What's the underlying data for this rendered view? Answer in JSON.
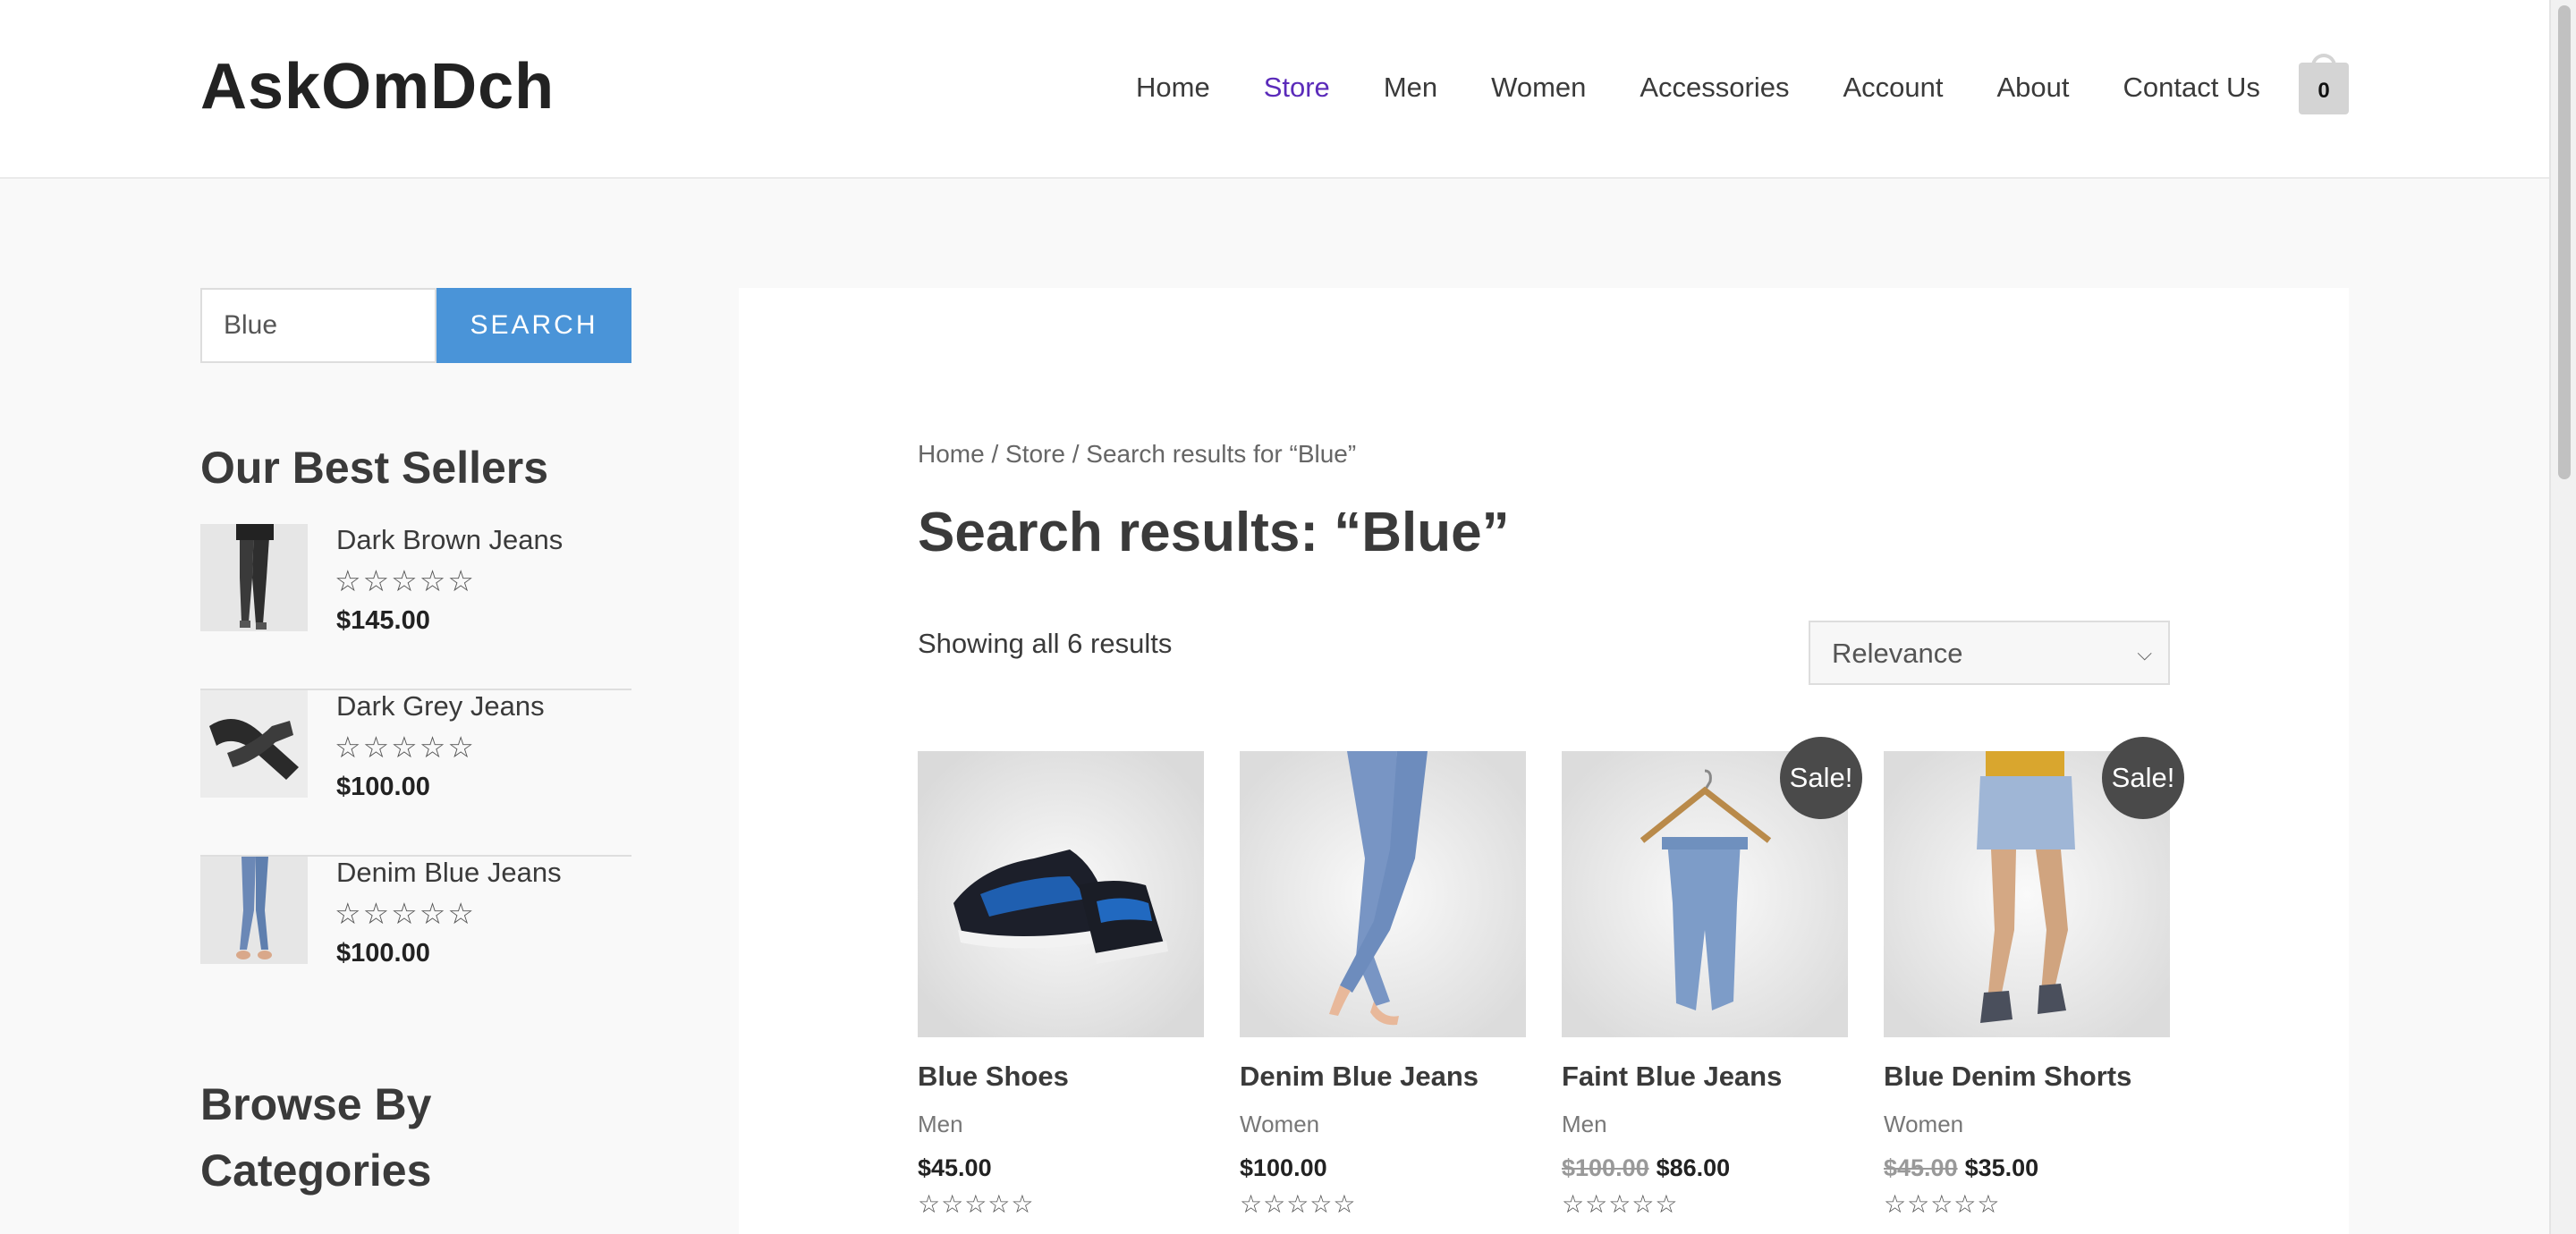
{
  "site": {
    "logo": "AskOmDch",
    "cart_count": "0"
  },
  "nav": [
    "Home",
    "Store",
    "Men",
    "Women",
    "Accessories",
    "Account",
    "About",
    "Contact Us"
  ],
  "nav_active": "Store",
  "sidebar": {
    "search_value": "Blue",
    "search_button": "SEARCH",
    "best_sellers_title": "Our Best Sellers",
    "best_sellers": [
      {
        "name": "Dark Brown Jeans",
        "price": "$145.00",
        "stars": "☆☆☆☆☆",
        "rating": 0
      },
      {
        "name": "Dark Grey Jeans",
        "price": "$100.00",
        "stars": "☆☆☆☆☆",
        "rating": 0
      },
      {
        "name": "Denim Blue Jeans",
        "price": "$100.00",
        "stars": "☆☆☆☆☆",
        "rating": 0
      }
    ],
    "categories_title": "Browse By Categories"
  },
  "main": {
    "breadcrumb": "Home / Store / Search results for “Blue”",
    "title": "Search results: “Blue”",
    "result_count": "Showing all 6 results",
    "orderby": "Relevance",
    "products": [
      {
        "name": "Blue Shoes",
        "category": "Men",
        "old_price": "",
        "price": "$45.00",
        "sale": "",
        "stars": "☆☆☆☆☆",
        "rating": 0
      },
      {
        "name": "Denim Blue Jeans",
        "category": "Women",
        "old_price": "",
        "price": "$100.00",
        "sale": "",
        "stars": "☆☆☆☆☆",
        "rating": 0
      },
      {
        "name": "Faint Blue Jeans",
        "category": "Men",
        "old_price": "$100.00",
        "price": "$86.00",
        "sale": "Sale!",
        "stars": "☆☆☆☆☆",
        "rating": 0
      },
      {
        "name": "Blue Denim Shorts",
        "category": "Women",
        "old_price": "$45.00",
        "price": "$35.00",
        "sale": "Sale!",
        "stars": "☆☆☆☆☆",
        "rating": 0
      }
    ]
  },
  "colors": {
    "accent": "#4a94d8",
    "nav_active": "#5b2bba",
    "sale_badge": "#4a4a4a"
  }
}
